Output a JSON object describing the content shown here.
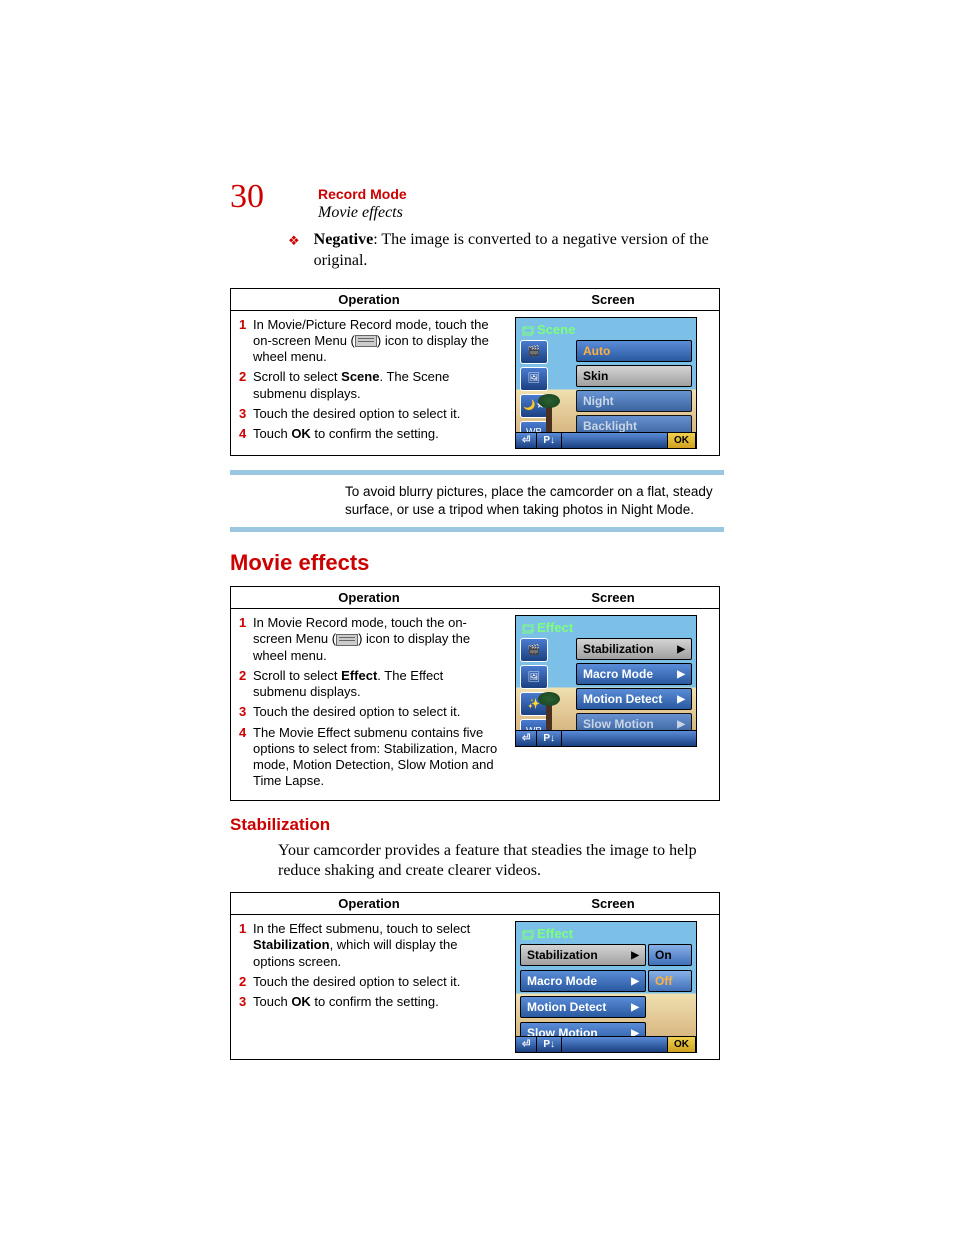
{
  "pageNumber": "30",
  "chapter": "Record Mode",
  "section": "Movie effects",
  "bullet": {
    "term": "Negative",
    "rest": ": The image is converted to a negative version of the original."
  },
  "headers": {
    "op": "Operation",
    "scr": "Screen"
  },
  "table1": {
    "steps": [
      {
        "n": "1",
        "pre": "In Movie/Picture Record mode, touch the on-screen Menu (",
        "post": ") icon to display the wheel menu."
      },
      {
        "n": "2",
        "pre": "Scroll to select ",
        "b": "Scene",
        "post": ". The Scene submenu displays."
      },
      {
        "n": "3",
        "pre": "Touch the desired option to select it."
      },
      {
        "n": "4",
        "pre": "Touch ",
        "b": "OK",
        "post": " to confirm the setting."
      }
    ],
    "screen": {
      "title": "Scene",
      "opts": [
        {
          "t": "Auto",
          "cls": "orange"
        },
        {
          "t": "Skin",
          "cls": "sel"
        },
        {
          "t": "Night",
          "cls": "dim"
        },
        {
          "t": "Backlight",
          "cls": "dim"
        }
      ],
      "ok": "OK",
      "pl": "P↓",
      "back": "⏎"
    }
  },
  "note": "To avoid blurry pictures, place the camcorder on a flat, steady surface, or use a tripod when taking photos in Night Mode.",
  "h1": "Movie effects",
  "table2": {
    "steps": [
      {
        "n": "1",
        "pre": "In Movie Record mode, touch the on-screen Menu (",
        "post": ") icon to display the wheel menu."
      },
      {
        "n": "2",
        "pre": "Scroll to select ",
        "b": "Effect",
        "post": ". The Effect submenu displays."
      },
      {
        "n": "3",
        "pre": "Touch the desired option to select it."
      },
      {
        "n": "4",
        "pre": "The Movie Effect submenu contains five options to select from: Stabilization, Macro mode, Motion Detection, Slow Motion and Time Lapse."
      }
    ],
    "screen": {
      "title": "Effect",
      "opts": [
        {
          "t": "Stabilization",
          "cls": "sel"
        },
        {
          "t": "Macro Mode",
          "cls": ""
        },
        {
          "t": "Motion Detect",
          "cls": ""
        },
        {
          "t": "Slow Motion",
          "cls": "dim"
        }
      ],
      "pl": "P↓",
      "back": "⏎"
    }
  },
  "h2": "Stabilization",
  "stabPara": "Your camcorder provides a feature that steadies the image to help reduce shaking and create clearer videos.",
  "table3": {
    "steps": [
      {
        "n": "1",
        "pre": "In the Effect submenu, touch to select ",
        "b": "Stabilization",
        "post": ", which will display the options screen."
      },
      {
        "n": "2",
        "pre": "Touch the desired option to select it."
      },
      {
        "n": "3",
        "pre": "Touch ",
        "b": "OK",
        "post": " to confirm the setting."
      }
    ],
    "screen": {
      "title": "Effect",
      "left": [
        {
          "t": "Stabilization",
          "cls": "sel"
        },
        {
          "t": "Macro Mode",
          "cls": ""
        },
        {
          "t": "Motion Detect",
          "cls": ""
        },
        {
          "t": "Slow Motion",
          "cls": ""
        }
      ],
      "right": [
        {
          "t": "On",
          "cls": "sel"
        },
        {
          "t": "Off",
          "cls": "off"
        }
      ],
      "ok": "OK",
      "pl": "P↓",
      "back": "⏎"
    }
  }
}
